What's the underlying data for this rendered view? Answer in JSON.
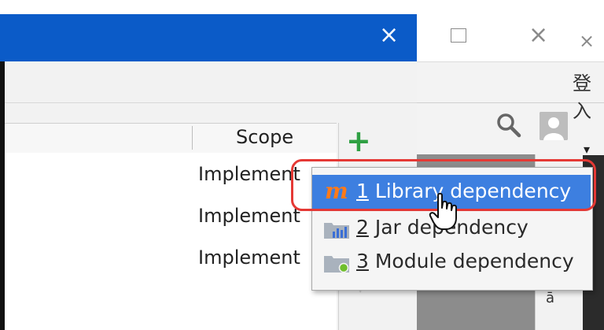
{
  "dialog": {
    "close_glyph": "×",
    "titlebar_color": "#0b5bc8",
    "table": {
      "columns": [
        "",
        "Scope"
      ],
      "rows": [
        {
          "scope": "Implement"
        },
        {
          "scope": "Implement"
        },
        {
          "scope": "Implement"
        }
      ]
    },
    "toolbar": {
      "add_glyph": "+",
      "add_color": "#2fa043",
      "down_glyph": "▼"
    }
  },
  "popup_menu": {
    "items": [
      {
        "mnemonic": "1",
        "label": "Library dependency",
        "icon": "maven-icon",
        "icon_glyph": "m",
        "selected": true
      },
      {
        "mnemonic": "2",
        "label": "Jar dependency",
        "icon": "jar-icon",
        "selected": false
      },
      {
        "mnemonic": "3",
        "label": "Module dependency",
        "icon": "module-icon",
        "selected": false
      }
    ],
    "selected_color": "#3d7fe0",
    "highlight_ring_color": "#e53935"
  },
  "background_window": {
    "close_glyph": "×",
    "side_close_glyph": "×",
    "cjk_text": "登入",
    "dropdown_glyph": "▾",
    "side_glyph": "ā"
  }
}
